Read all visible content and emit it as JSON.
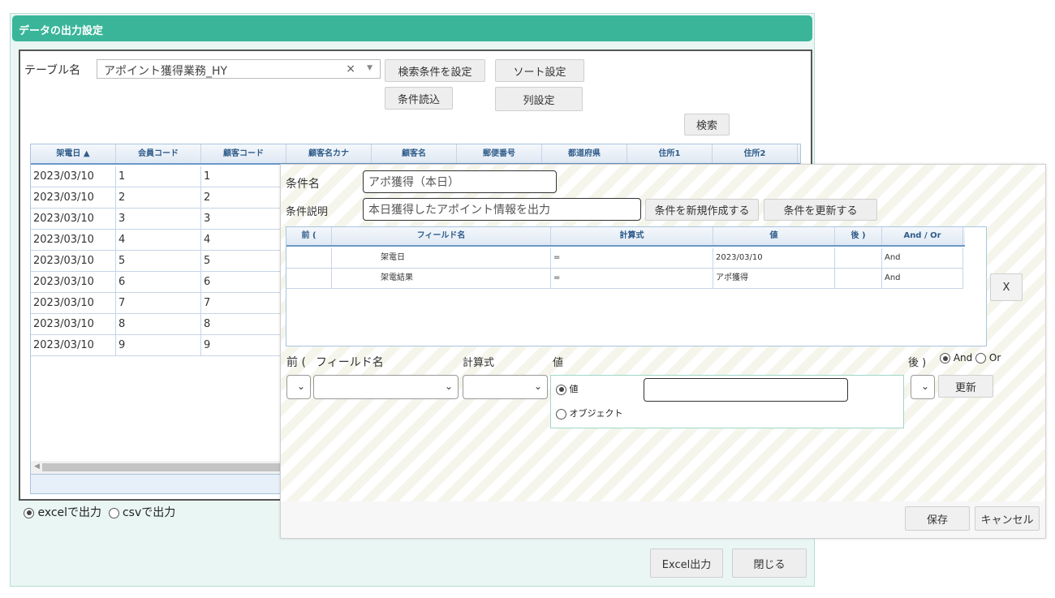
{
  "main": {
    "title": "データの出力設定",
    "table_label": "テーブル名",
    "table_value": "アポイント獲得業務_HY",
    "clear_glyph": "×",
    "buttons": {
      "search_cond": "検索条件を設定",
      "sort": "ソート設定",
      "load_cond": "条件読込",
      "columns": "列設定",
      "search": "検索",
      "excel_out": "Excel出力",
      "close": "閉じる"
    },
    "grid": {
      "columns": [
        "架電日 ▲",
        "会員コード",
        "顧客コード",
        "顧客名カナ",
        "顧客名",
        "郵便番号",
        "都道府県",
        "住所1",
        "住所2"
      ],
      "rows": [
        [
          "2023/03/10",
          "1",
          "1"
        ],
        [
          "2023/03/10",
          "2",
          "2"
        ],
        [
          "2023/03/10",
          "3",
          "3"
        ],
        [
          "2023/03/10",
          "4",
          "4"
        ],
        [
          "2023/03/10",
          "5",
          "5"
        ],
        [
          "2023/03/10",
          "6",
          "6"
        ],
        [
          "2023/03/10",
          "7",
          "7"
        ],
        [
          "2023/03/10",
          "8",
          "8"
        ],
        [
          "2023/03/10",
          "9",
          "9"
        ]
      ]
    },
    "output": {
      "excel_label": "excelで出力",
      "csv_label": "csvで出力",
      "selected": "excel"
    }
  },
  "condition": {
    "name_label": "条件名",
    "name_value": "アポ獲得（本日）",
    "desc_label": "条件説明",
    "desc_value": "本日獲得したアポイント情報を出力",
    "buttons": {
      "create_new": "条件を新規作成する",
      "update": "条件を更新する",
      "close_x": "X",
      "apply": "更新",
      "save": "保存",
      "cancel": "キャンセル"
    },
    "grid": {
      "columns": [
        "前 (",
        "フィールド名",
        "計算式",
        "値",
        "後 )",
        "And / Or"
      ],
      "rows": [
        [
          "",
          "架電日",
          "=",
          "2023/03/10",
          "",
          "And"
        ],
        [
          "",
          "架電結果",
          "=",
          "アポ獲得",
          "",
          "And"
        ]
      ]
    },
    "editor": {
      "pre_label": "前 (",
      "field_label": "フィールド名",
      "calc_label": "計算式",
      "value_label": "値",
      "post_label": "後 )",
      "and_label": "And",
      "or_label": "Or",
      "value_radio_label": "値",
      "object_radio_label": "オブジェクト",
      "chevron": "⌄"
    }
  }
}
